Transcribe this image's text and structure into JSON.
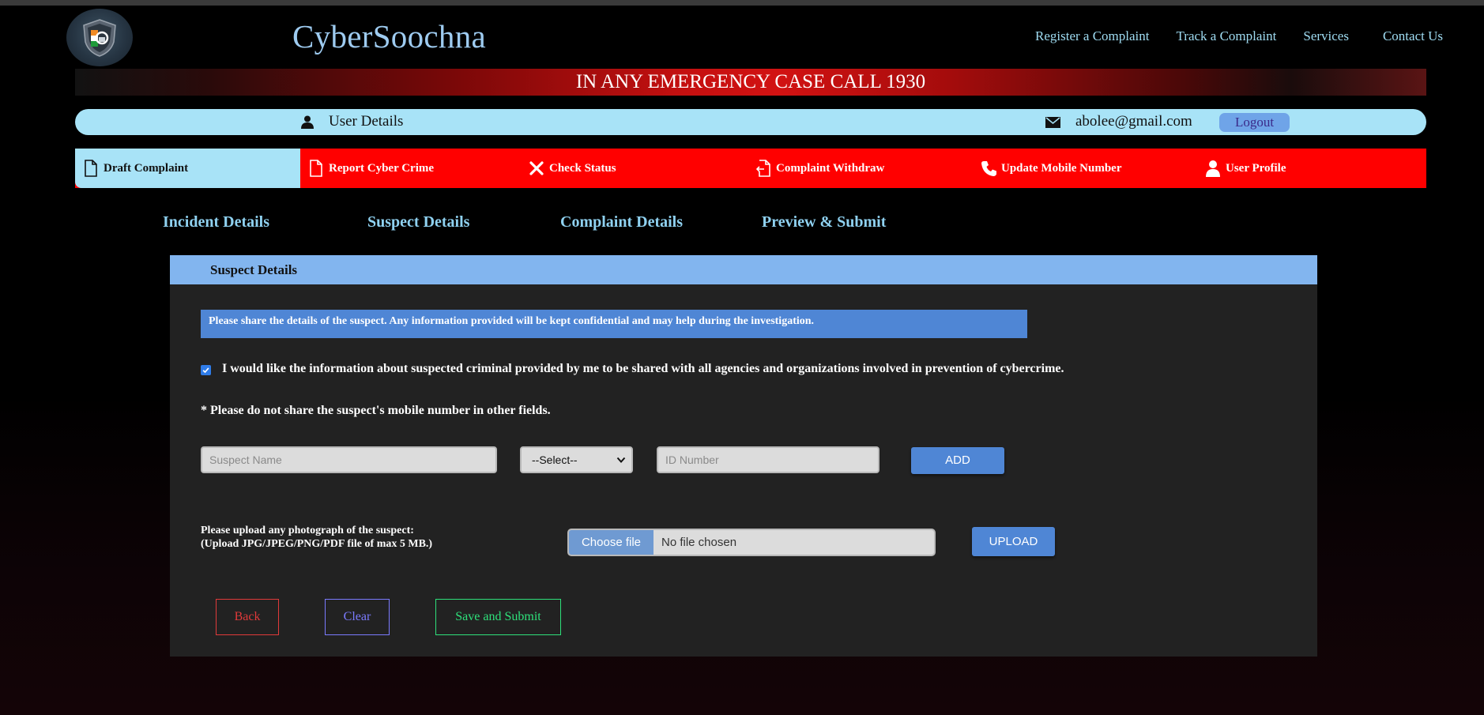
{
  "header": {
    "brand": "CyberSoochna",
    "nav": [
      "Register a Complaint",
      "Track a Complaint",
      "Services",
      "Contact Us"
    ]
  },
  "emergency_banner": "IN ANY EMERGENCY CASE CALL 1930",
  "userbar": {
    "label": "User Details",
    "email": "abolee@gmail.com",
    "logout_label": "Logout"
  },
  "tabs": [
    {
      "label": "Draft Complaint",
      "icon": "document-icon"
    },
    {
      "label": "Report Cyber Crime",
      "icon": "document-icon"
    },
    {
      "label": "Check Status",
      "icon": "close-x-icon"
    },
    {
      "label": "Complaint Withdraw",
      "icon": "file-export-icon"
    },
    {
      "label": "Update Mobile Number",
      "icon": "phone-icon"
    },
    {
      "label": "User Profile",
      "icon": "user-icon"
    }
  ],
  "steps": [
    "Incident Details",
    "Suspect Details",
    "Complaint Details",
    "Preview & Submit"
  ],
  "panel": {
    "title": "Suspect Details",
    "info": "Please share the details of the suspect. Any information provided will be kept confidential and may help during the investigation.",
    "share_checkbox_label": "I would like the information about suspected criminal provided by me to be shared with all agencies and organizations involved in prevention of cybercrime.",
    "share_checked": true,
    "note": "* Please do not share the suspect's mobile number in other fields.",
    "suspect_name_placeholder": "Suspect Name",
    "id_type_selected": "--Select--",
    "id_number_placeholder": "ID Number",
    "add_label": "ADD",
    "upload_label_line1": "Please upload any photograph of the suspect:",
    "upload_label_line2": "(Upload JPG/JPEG/PNG/PDF file of max 5 MB.)",
    "choose_file_label": "Choose file",
    "no_file_label": "No file chosen",
    "upload_button": "UPLOAD",
    "back_label": "Back",
    "clear_label": "Clear",
    "save_submit_label": "Save and Submit"
  },
  "colors": {
    "brand": "#9ecbf0",
    "tab_bar": "#ff0000",
    "active_tab": "#a8e3f7",
    "panel_header": "#82b5ef",
    "info_bar": "#4f86d5",
    "back_btn": "#e03a3a",
    "clear_btn": "#7b7bff",
    "submit_btn": "#2ee07a"
  }
}
